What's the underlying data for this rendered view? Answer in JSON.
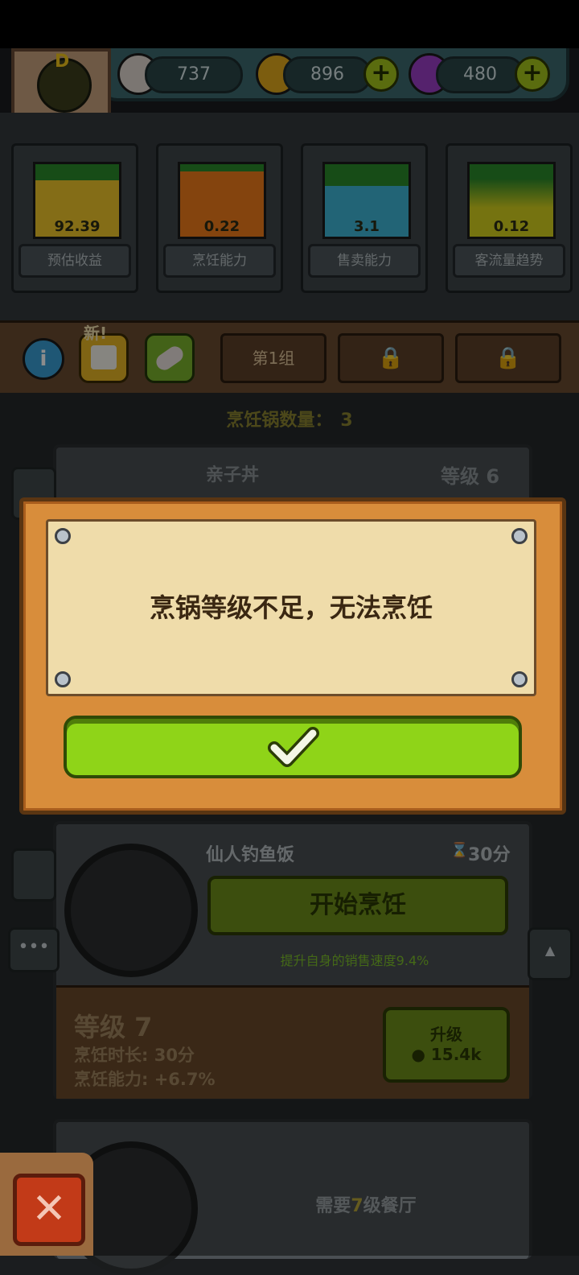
{
  "resources": {
    "eyes": "737",
    "coins": "896",
    "potions": "480"
  },
  "stats": [
    {
      "value": "92.39",
      "label": "预估收益",
      "color": "#f1c62a"
    },
    {
      "value": "0.22",
      "label": "烹饪能力",
      "color": "#f07d1a"
    },
    {
      "value": "3.1",
      "label": "售卖能力",
      "color": "#3fb6d8"
    },
    {
      "value": "0.12",
      "label": "客流量趋势",
      "color": "#d6d21e"
    }
  ],
  "tabs": {
    "new_badge": "新!",
    "group1": "第1组"
  },
  "pot_count": {
    "label": "烹饪锅数量：",
    "value": "3"
  },
  "card1": {
    "dish": "亲子丼",
    "level": "等级 6"
  },
  "card2": {
    "dish": "仙人钓鱼饭",
    "time": "30分",
    "start_button": "开始烹饪",
    "bonus": "提升自身的销售速度9.4%",
    "level": "等级 7",
    "cook_time": "烹饪时长: 30分",
    "cook_power": "烹饪能力: +6.7%",
    "upgrade_label": "升级",
    "upgrade_cost": "15.4k"
  },
  "card3": {
    "req_prefix": "需要",
    "req_num": "7",
    "req_suffix": "级餐厅"
  },
  "dialog": {
    "message": "烹锅等级不足，无法烹饪"
  }
}
